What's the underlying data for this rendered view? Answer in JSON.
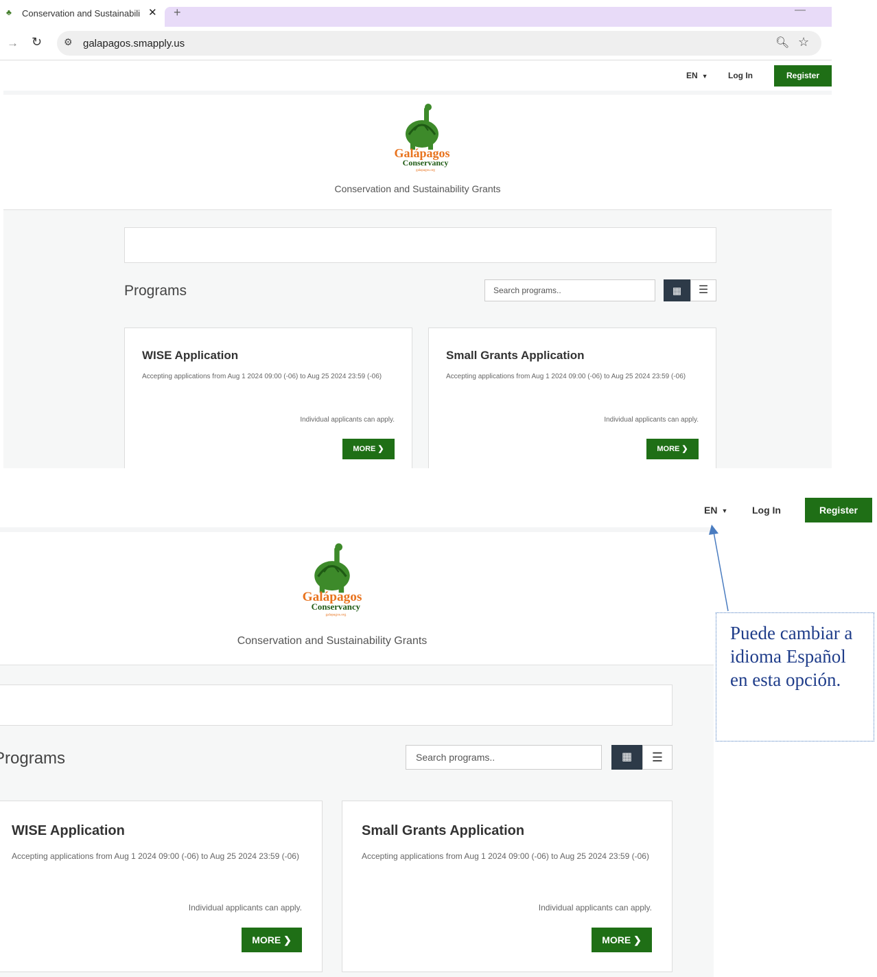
{
  "browser": {
    "tab_title": "Conservation and Sustainability",
    "url": "galapagos.smapply.us"
  },
  "header": {
    "language": "EN",
    "login": "Log In",
    "register": "Register"
  },
  "banner": {
    "logo_name": "Galápagos",
    "logo_sub": "Conservancy",
    "logo_url": "galapagos.org",
    "subtitle": "Conservation and Sustainability Grants"
  },
  "programs": {
    "title": "Programs",
    "search_placeholder": "Search programs..",
    "cards": [
      {
        "title": "WISE Application",
        "description": "Accepting applications from Aug 1 2024 09:00 (-06) to Aug 25 2024 23:59 (-06)",
        "eligibility": "Individual applicants can apply.",
        "more": "MORE"
      },
      {
        "title": "Small Grants Application",
        "description": "Accepting applications from Aug 1 2024 09:00 (-06) to Aug 25 2024 23:59 (-06)",
        "eligibility": "Individual applicants can apply.",
        "more": "MORE"
      }
    ]
  },
  "annotation": {
    "text": "Puede cambiar a idioma Español en esta opción."
  },
  "colors": {
    "brand_green": "#1f6f16",
    "logo_orange": "#e8731e",
    "callout_blue": "#1f3d8a"
  }
}
